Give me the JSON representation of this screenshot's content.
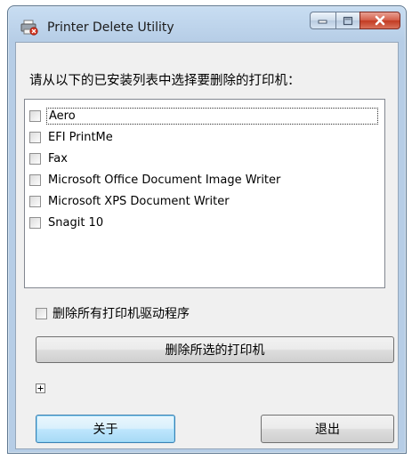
{
  "window": {
    "title": "Printer Delete Utility"
  },
  "prompt": "请从以下的已安装列表中选择要删除的打印机：",
  "printers": [
    {
      "label": "Aero",
      "checked": false,
      "focused": true
    },
    {
      "label": "EFI PrintMe",
      "checked": false
    },
    {
      "label": "Fax",
      "checked": false
    },
    {
      "label": "Microsoft Office Document Image Writer",
      "checked": false
    },
    {
      "label": "Microsoft XPS Document Writer",
      "checked": false
    },
    {
      "label": "Snagit 10",
      "checked": false
    }
  ],
  "delete_drivers": {
    "label": "删除所有打印机驱动程序",
    "checked": false
  },
  "buttons": {
    "delete_selected": "删除所选的打印机",
    "about": "关于",
    "exit": "退出"
  },
  "icons": {
    "app": "printer-delete-icon",
    "expand": "plus-icon",
    "minimize": "minimize-icon",
    "maximize": "maximize-icon",
    "close": "close-icon"
  },
  "colors": {
    "close_button": "#c23b22",
    "default_button_border": "#3c7fb1",
    "titlebar": "#b6cde6"
  }
}
